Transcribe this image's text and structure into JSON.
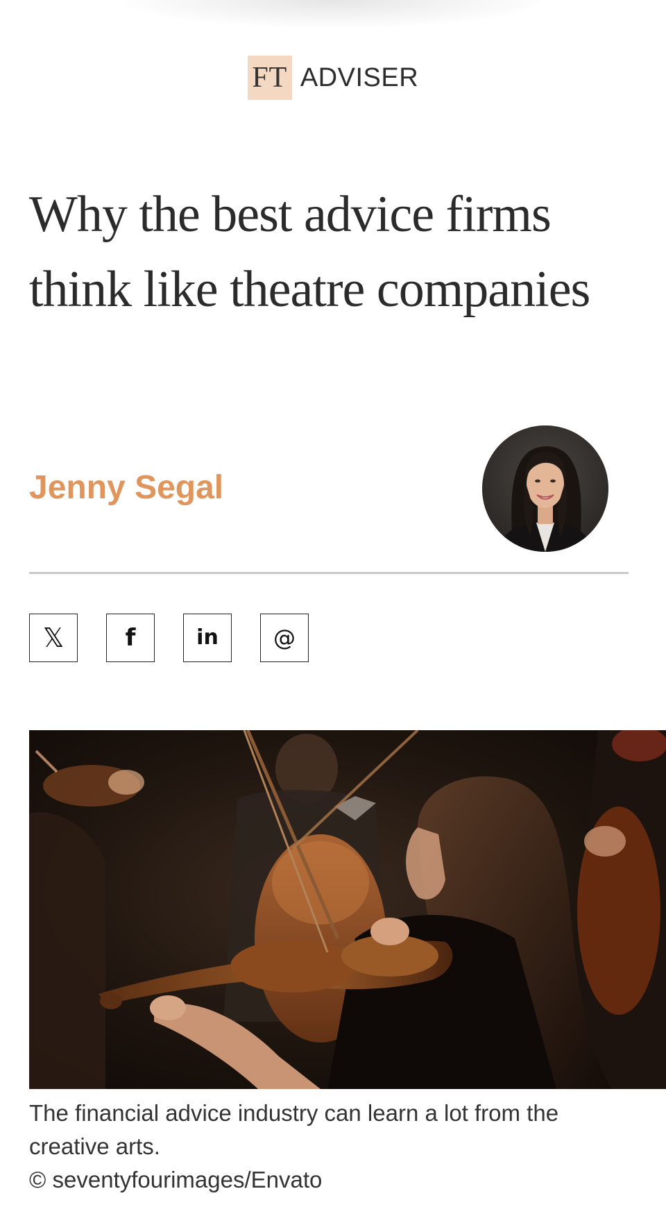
{
  "masthead": {
    "logo_mark": "FT",
    "logo_wordmark": "ADVISER"
  },
  "article": {
    "headline": "Why the best advice firms think like theatre companies",
    "author": "Jenny Segal",
    "share": {
      "twitter_glyph": "𝕏",
      "facebook_glyph": "f",
      "linkedin_glyph": "in",
      "email_glyph": "@"
    },
    "image": {
      "caption": "The financial advice industry can learn a lot from the creative arts.",
      "credit": "© seventyfourimages/Envato"
    }
  },
  "colors": {
    "brand_tint": "#f5d8c2",
    "author_accent": "#e0955c",
    "headline_text": "#2b2b2b"
  },
  "icons": [
    "x-twitter-icon",
    "facebook-icon",
    "linkedin-icon",
    "email-icon"
  ]
}
